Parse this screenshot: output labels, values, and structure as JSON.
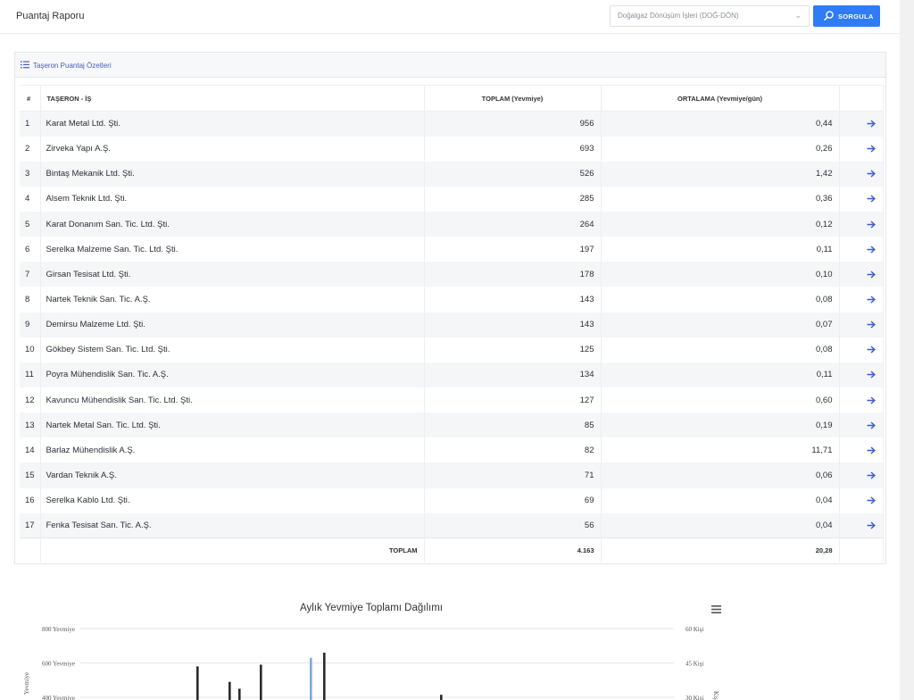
{
  "header": {
    "title": "Puantaj Raporu",
    "project_select_value": "Doğalgaz Dönüşüm İşleri (DOĞ-DÖN)",
    "query_button_label": "SORGULA"
  },
  "summary": {
    "card_title": "Taşeron Puantaj Özetleri",
    "columns": [
      "#",
      "TAŞERON - İŞ",
      "TOPLAM (Yevmiye)",
      "ORTALAMA (Yevmiye/gün)"
    ],
    "rows": [
      {
        "no": "1",
        "name": "Karat Metal Ltd. Şti.",
        "total": "956",
        "avg": "0,44"
      },
      {
        "no": "2",
        "name": "Zirveka Yapı A.Ş.",
        "total": "693",
        "avg": "0,26"
      },
      {
        "no": "3",
        "name": "Bintaş Mekanik Ltd. Şti.",
        "total": "526",
        "avg": "1,42"
      },
      {
        "no": "4",
        "name": "Alsem Teknik Ltd. Şti.",
        "total": "285",
        "avg": "0,36"
      },
      {
        "no": "5",
        "name": "Karat Donanım San. Tic. Ltd. Şti.",
        "total": "264",
        "avg": "0,12"
      },
      {
        "no": "6",
        "name": "Serelka Malzeme San. Tic. Ltd. Şti.",
        "total": "197",
        "avg": "0,11"
      },
      {
        "no": "7",
        "name": "Girsan Tesisat Ltd. Şti.",
        "total": "178",
        "avg": "0,10"
      },
      {
        "no": "8",
        "name": "Nartek Teknik San. Tic. A.Ş.",
        "total": "143",
        "avg": "0,08"
      },
      {
        "no": "9",
        "name": "Demirsu Malzeme Ltd. Şti.",
        "total": "143",
        "avg": "0,07"
      },
      {
        "no": "10",
        "name": "Gökbey Sistem San. Tic. Ltd. Şti.",
        "total": "125",
        "avg": "0,08"
      },
      {
        "no": "11",
        "name": "Poyra Mühendislik San. Tic. A.Ş.",
        "total": "134",
        "avg": "0,11"
      },
      {
        "no": "12",
        "name": "Kavuncu Mühendislik San. Tic. Ltd. Şti.",
        "total": "127",
        "avg": "0,60"
      },
      {
        "no": "13",
        "name": "Nartek Metal San. Tic. Ltd. Şti.",
        "total": "85",
        "avg": "0,19"
      },
      {
        "no": "14",
        "name": "Barlaz Mühendislik A.Ş.",
        "total": "82",
        "avg": "11,71"
      },
      {
        "no": "15",
        "name": "Vardan Teknik A.Ş.",
        "total": "71",
        "avg": "0,06"
      },
      {
        "no": "16",
        "name": "Serelka Kablo Ltd. Şti.",
        "total": "69",
        "avg": "0,04"
      },
      {
        "no": "17",
        "name": "Fenka Tesisat San. Tic. A.Ş.",
        "total": "56",
        "avg": "0,04"
      }
    ],
    "footer": {
      "label": "TOPLAM",
      "total": "4.163",
      "avg": "20,28"
    }
  },
  "colors": {
    "accent": "#2f7cf6",
    "link": "#3b5bdb",
    "bar_dark": "#2b2b2b",
    "bar_highlight": "#7ea6d8"
  },
  "chart_data": {
    "type": "bar",
    "title": "Aylık Yevmiye Toplamı Dağılımı",
    "ylabel": "Yevmiye",
    "y_ticks_left": [
      "800 Yevmiye",
      "600 Yevmiye",
      "400 Yevmiye"
    ],
    "y_ticks_right": [
      "60 Kişi",
      "45 Kişi",
      "30 Kişi"
    ],
    "ylim_left": [
      0,
      800
    ],
    "ylim_right": [
      0,
      60
    ],
    "bars_visible_top_values": [
      580,
      490,
      450,
      590,
      630,
      660,
      415
    ],
    "highlighted_bar_index": 4
  }
}
